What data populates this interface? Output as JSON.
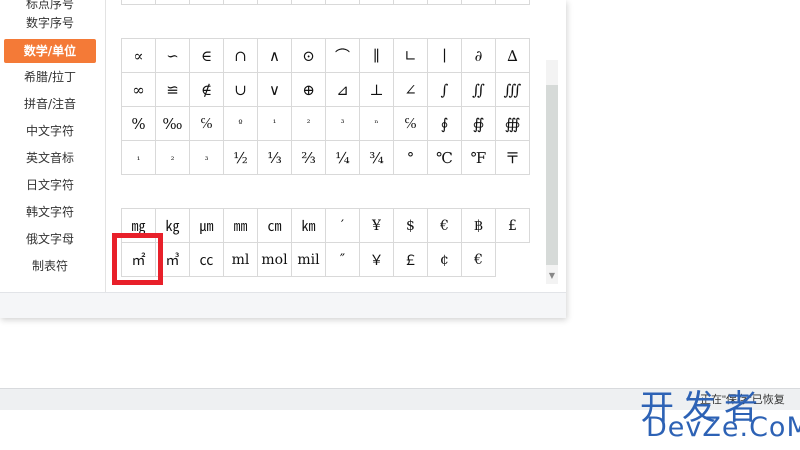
{
  "sidebar": {
    "items": [
      {
        "label": "标点序号"
      },
      {
        "label": "数字序号"
      },
      {
        "label": "数学/单位",
        "active": true
      },
      {
        "label": "希腊/拉丁"
      },
      {
        "label": "拼音/注音"
      },
      {
        "label": "中文字符"
      },
      {
        "label": "英文音标"
      },
      {
        "label": "日文字符"
      },
      {
        "label": "韩文字符"
      },
      {
        "label": "俄文字母"
      },
      {
        "label": "制表符"
      }
    ]
  },
  "math_symbols": {
    "rows": [
      [
        "∝",
        "∽",
        "∈",
        "∩",
        "∧",
        "⊙",
        "⌒",
        "∥",
        "∟",
        "∣",
        "∂",
        "∆"
      ],
      [
        "∞",
        "≌",
        "∉",
        "∪",
        "∨",
        "⊕",
        "⊿",
        "⊥",
        "∠",
        "∫",
        "∬",
        "∭"
      ],
      [
        "%",
        "‰",
        "℅",
        "º",
        "¹",
        "²",
        "³",
        "ⁿ",
        "℅",
        "∮",
        "∯",
        "∰"
      ],
      [
        "₁",
        "₂",
        "₃",
        "½",
        "⅓",
        "⅔",
        "¼",
        "¾",
        "°",
        "℃",
        "℉",
        "〒"
      ]
    ]
  },
  "unit_symbols": {
    "rows": [
      [
        "㎎",
        "㎏",
        "㎛",
        "㎜",
        "㎝",
        "㎞",
        "′",
        "¥",
        "$",
        "€",
        "฿",
        "£"
      ],
      [
        "㎡",
        "㎥",
        "㏄",
        "ml",
        "mol",
        "mil",
        "″",
        "￥",
        "￡",
        "¢",
        "€"
      ]
    ]
  },
  "status_bar": {
    "text": "正在\"保存\"已恢复"
  },
  "watermark": {
    "line1": "开发者",
    "line2": "DevZe.CoM"
  },
  "colors": {
    "active_tab": "#f47a37",
    "highlight": "#e8202a",
    "watermark": "#2d62b5"
  }
}
